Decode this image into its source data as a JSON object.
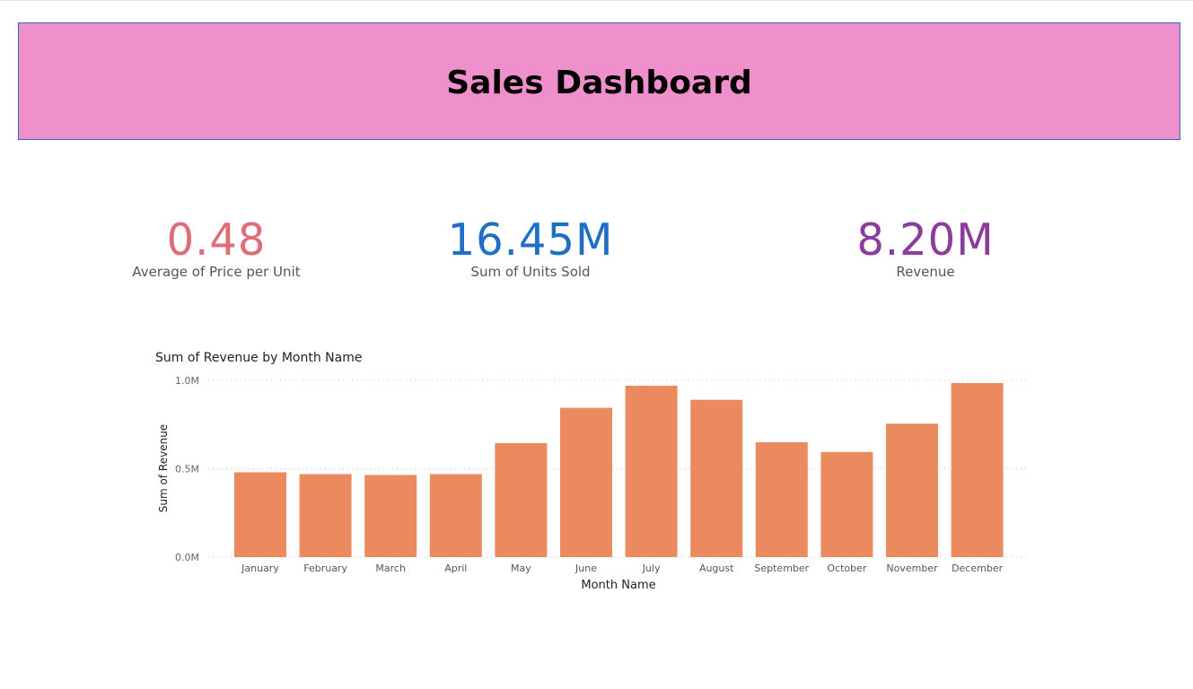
{
  "header": {
    "title": "Sales Dashboard",
    "bg_color": "#ef8fcc"
  },
  "kpis": [
    {
      "value": "0.48",
      "label": "Average of Price per Unit",
      "color": "#e06d75"
    },
    {
      "value": "16.45M",
      "label": "Sum of Units Sold",
      "color": "#1f6fc4"
    },
    {
      "value": "8.20M",
      "label": "Revenue",
      "color": "#8a3d9c"
    }
  ],
  "chart_data": {
    "type": "bar",
    "title": "Sum of Revenue by Month Name",
    "xlabel": "Month Name",
    "ylabel": "Sum of Revenue",
    "categories": [
      "January",
      "February",
      "March",
      "April",
      "May",
      "June",
      "July",
      "August",
      "September",
      "October",
      "November",
      "December"
    ],
    "values": [
      0.48,
      0.47,
      0.465,
      0.47,
      0.645,
      0.845,
      0.97,
      0.89,
      0.65,
      0.595,
      0.755,
      0.985
    ],
    "yticks": [
      "0.0M",
      "0.5M",
      "1.0M"
    ],
    "ytick_values": [
      0,
      0.5,
      1.0
    ],
    "ylim": [
      0,
      1.0
    ],
    "bar_color": "#eb8a5e",
    "grid": true
  }
}
